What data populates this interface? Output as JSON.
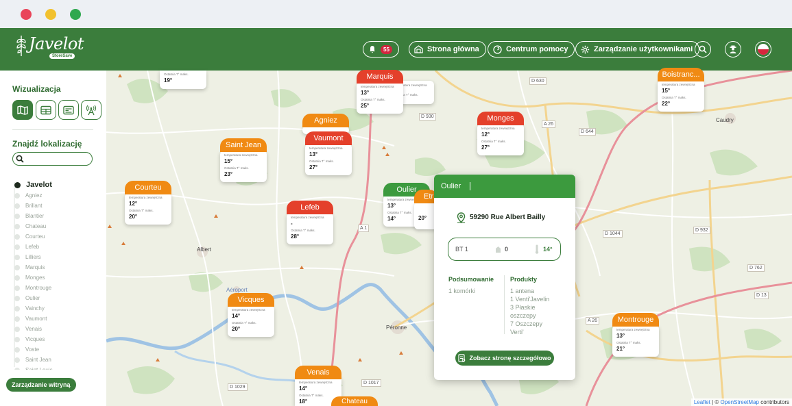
{
  "app": {
    "name": "Javelot",
    "sub": "StoreSave"
  },
  "header": {
    "notifications_count": "55",
    "home_label": "Strona główna",
    "help_label": "Centrum pomocy",
    "users_label": "Zarządzanie użytkownikami"
  },
  "sidebar": {
    "viz_title": "Wizualizacja",
    "find_title": "Znajdź lokalizację",
    "search_value": "",
    "locations": [
      "Javelot",
      "Agniez",
      "Brillant",
      "Blantier",
      "Chateau",
      "Courteu",
      "Lefeb",
      "Lilliers",
      "Marquis",
      "Monges",
      "Montrouge",
      "Oulier",
      "Vainchy",
      "Vaumont",
      "Venais",
      "Vicques",
      "Voste",
      "Saint Jean",
      "Saint Louis"
    ],
    "manage_label": "Zarządzanie witryną"
  },
  "pins": {
    "temp_label": "temperatura zewnętrzna",
    "max_label": "Ostatnia T° maks.",
    "items": [
      {
        "name": "Marquis",
        "temp": "13°",
        "max": "25°"
      },
      {
        "name": "Monges",
        "temp": "12°",
        "max": "27°"
      },
      {
        "name": "Boistranc...",
        "temp": "15°",
        "max": "22°"
      },
      {
        "name": "Agniez",
        "temp": "",
        "max": ""
      },
      {
        "name": "Vaumont",
        "temp": "13°",
        "max": "27°"
      },
      {
        "name": "Saint Jean",
        "temp": "15°",
        "max": "23°"
      },
      {
        "name": "Courteu",
        "temp": "12°",
        "max": "20°"
      },
      {
        "name": "Lefeb",
        "temp": "-",
        "max": "28°"
      },
      {
        "name": "Oulier",
        "temp": "13°",
        "max": "14°"
      },
      {
        "name": "Etr",
        "temp": "",
        "max": "20°"
      },
      {
        "name": "Vicques",
        "temp": "14°",
        "max": "20°"
      },
      {
        "name": "Montrouge",
        "temp": "13°",
        "max": "21°"
      },
      {
        "name": "Venais",
        "temp": "14°",
        "max": "18°"
      },
      {
        "name": "Chateau",
        "temp": "",
        "max": ""
      },
      {
        "name": "",
        "temp": "",
        "max": "19°"
      }
    ]
  },
  "popup": {
    "title": "Oulier",
    "address": "59290 Rue Albert Bailly",
    "sensor_name": "BT 1",
    "sensor_count": "0",
    "sensor_temp": "14°",
    "summary_title": "Podsumowanie",
    "summary_lines": [
      "1 komórki"
    ],
    "products_title": "Produkty",
    "product_lines": [
      "1 antena",
      "1 Venti'Javelin",
      "3 Płaskie",
      "oszczepy",
      "7 Oszczepy",
      "Verti'"
    ],
    "detail_button": "Zobacz stronę szczegółowo"
  },
  "map": {
    "roads": [
      "D 630",
      "D 930",
      "A 26",
      "D 644",
      "D 1044",
      "D 932",
      "D 762",
      "D 13",
      "A 26",
      "A 1",
      "D 1029",
      "D 1017"
    ],
    "cities": [
      "Caudry",
      "Albert",
      "Aéroport",
      "Péronne"
    ],
    "attribution_leaflet": "Leaflet",
    "attribution_sep": " | © ",
    "attribution_osm": "OpenStreetMap",
    "attribution_tail": " contributors"
  },
  "colors": {
    "brand_green": "#3b7d3c",
    "orange": "#f08a13",
    "red": "#e4402b",
    "active_green": "#3c9a3e"
  }
}
